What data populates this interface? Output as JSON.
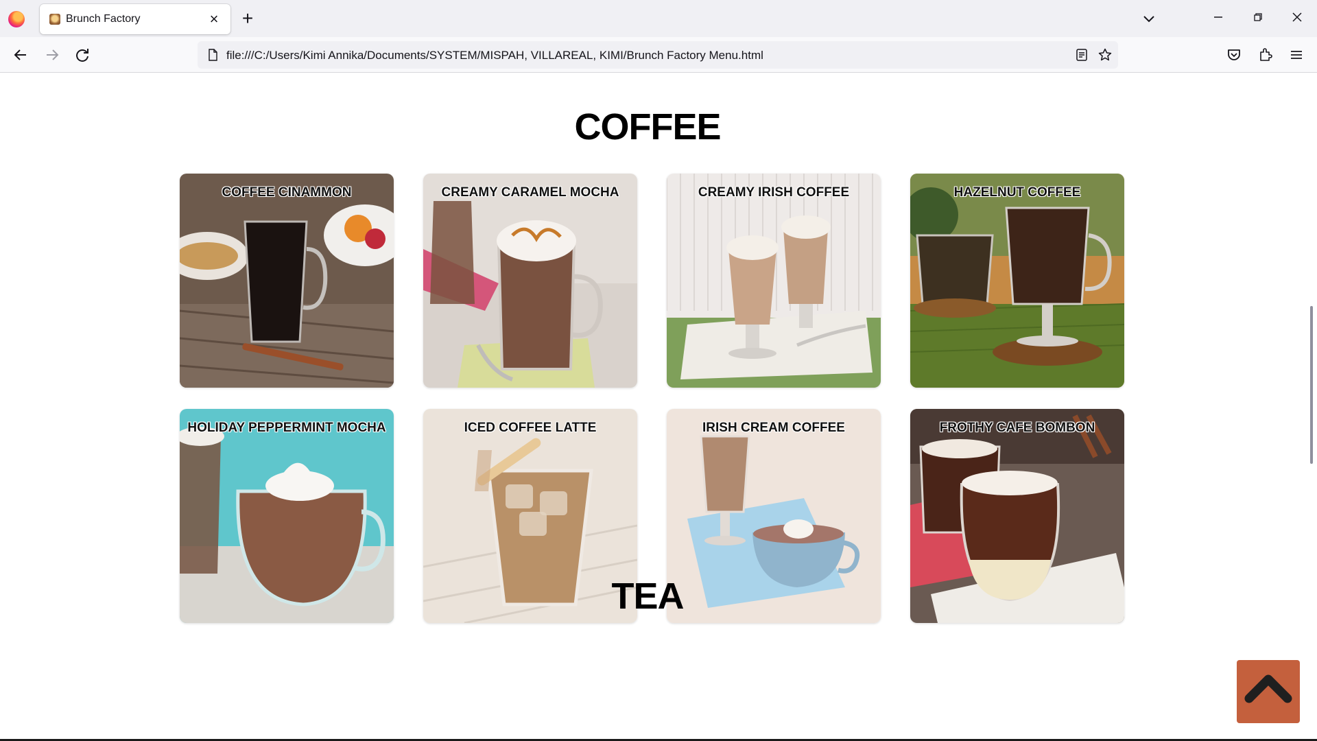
{
  "browser": {
    "tab_title": "Brunch Factory",
    "url": "file:///C:/Users/Kimi Annika/Documents/SYSTEM/MISPAH, VILLAREAL, KIMI/Brunch Factory Menu.html",
    "icons": [
      "firefox-logo",
      "tab-favicon",
      "close-icon",
      "plus-icon",
      "chevron-down-icon",
      "minimize-icon",
      "restore-icon",
      "window-close-icon",
      "back-arrow-icon",
      "forward-arrow-icon",
      "reload-icon",
      "page-icon",
      "reader-view-icon",
      "star-icon",
      "pocket-icon",
      "extensions-icon",
      "menu-icon"
    ]
  },
  "sections": {
    "coffee_title": "COFFEE",
    "tea_title": "TEA"
  },
  "coffee_items": [
    {
      "name": "COFFEE CINAMMON",
      "accent": "#1a1210"
    },
    {
      "name": "CREAMY CARAMEL MOCHA",
      "accent": "#7a5240"
    },
    {
      "name": "CREAMY IRISH COFFEE",
      "accent": "#c9a488"
    },
    {
      "name": "HAZELNUT COFFEE",
      "accent": "#3d2418"
    },
    {
      "name": "HOLIDAY PEPPERMINT MOCHA",
      "accent": "#8a5a44"
    },
    {
      "name": "ICED COFFEE LATTE",
      "accent": "#b99168"
    },
    {
      "name": "IRISH CREAM COFFEE",
      "accent": "#b08a70"
    },
    {
      "name": "FROTHY CAFE BOMBON",
      "accent": "#5a2a1a"
    }
  ],
  "colors": {
    "back_to_top_bg": "#c4603d",
    "back_to_top_icon": "#1f1f1f"
  }
}
